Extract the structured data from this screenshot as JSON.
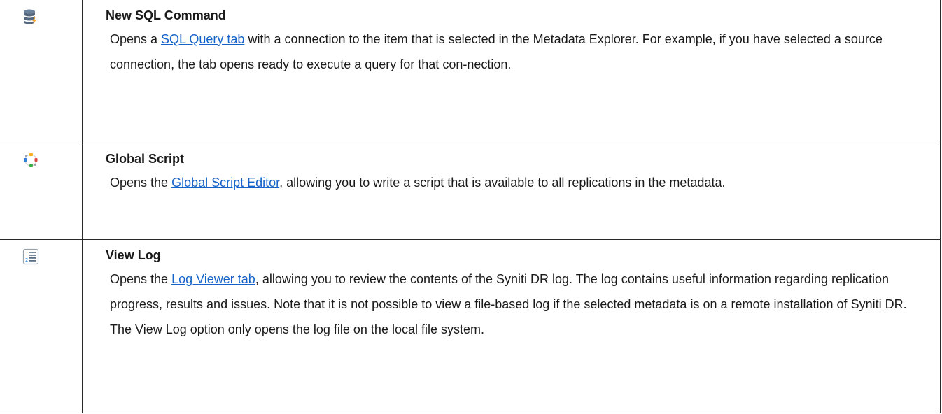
{
  "rows": [
    {
      "icon": "database-lightning-icon",
      "title": "New SQL Command",
      "pre": "Opens a ",
      "link": "SQL Query tab",
      "post": " with a connection to the item that is selected in the Metadata Explorer. For example, if you have selected a source connection, the tab opens ready to execute a query for that con-nection."
    },
    {
      "icon": "global-script-icon",
      "title": "Global Script",
      "pre": "Opens the ",
      "link": "Global Script Editor",
      "post": ", allowing you to write a script that is available to all replications in the metadata."
    },
    {
      "icon": "numbered-list-icon",
      "title": "View Log",
      "pre": "Opens the ",
      "link": "Log Viewer tab",
      "post": ", allowing you to review the contents of the Syniti DR log. The log contains useful information regarding  replication progress, results and issues. Note that it is not possible to view a file-based log if the selected metadata is on a remote installation of Syniti DR. The View Log option only opens the log file on the local file system."
    }
  ],
  "colors": {
    "link": "#1563c8",
    "border": "#2a2a2a",
    "db_icon": "#5a6f86",
    "lightning": "#f5a623"
  }
}
